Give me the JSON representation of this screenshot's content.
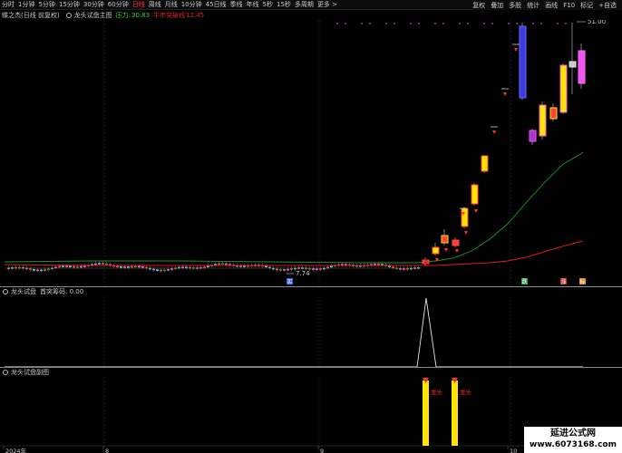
{
  "toolbar": {
    "left": [
      "分时",
      "1分钟",
      "5分钟",
      "15分钟",
      "30分钟",
      "60分钟",
      "日线",
      "周线",
      "月线",
      "10分钟",
      "45日线",
      "季线",
      "年线",
      "5秒",
      "15秒",
      "多周期",
      "更多 >"
    ],
    "active_index": 6,
    "right": [
      "复权",
      "叠加",
      "多股",
      "统计",
      "画线",
      "F10",
      "标记",
      "+自选"
    ]
  },
  "main_info": {
    "stock": "蝶之杰(日线 前复权)",
    "indicator": "龙头试盘主图",
    "pressure_label": "压力:",
    "pressure_value": "30.83",
    "line_label": "牛市突破线",
    "line_value": "12.45"
  },
  "sub1_info": {
    "name": "龙头试盘",
    "field": "首突筹码: 0.00"
  },
  "sub2_info": {
    "name": "龙头试盘副图"
  },
  "price_labels": {
    "high": "51.00",
    "low": "7.74"
  },
  "event_markers": [
    {
      "label": "买",
      "color": "#2a6ae0"
    },
    {
      "label": "跌",
      "color": "#27a040"
    },
    {
      "label": "涨",
      "color": "#d02828"
    },
    {
      "label": "标",
      "color": "#d88a20"
    }
  ],
  "signal_labels": [
    "龙头",
    "龙头"
  ],
  "date_labels": [
    "2024年",
    "8",
    "9",
    "10"
  ],
  "watermark": {
    "line1": "延进公式网",
    "line2": "www.6073168.com"
  },
  "colors": {
    "up": "#ff4040",
    "down": "#30e0e0",
    "ma_green": "#1a9a1a",
    "ma_red": "#dd1a1a",
    "signal": "#ffe400",
    "accent_purple": "#ee55ee"
  },
  "chart_data": {
    "type": "candlestick",
    "y_axis_max_label": 51.0,
    "y_axis_min_label": 7.74,
    "legend": [
      "压力",
      "牛市突破线"
    ],
    "sub_indicator": {
      "name": "首突筹码",
      "value": 0.0
    }
  }
}
